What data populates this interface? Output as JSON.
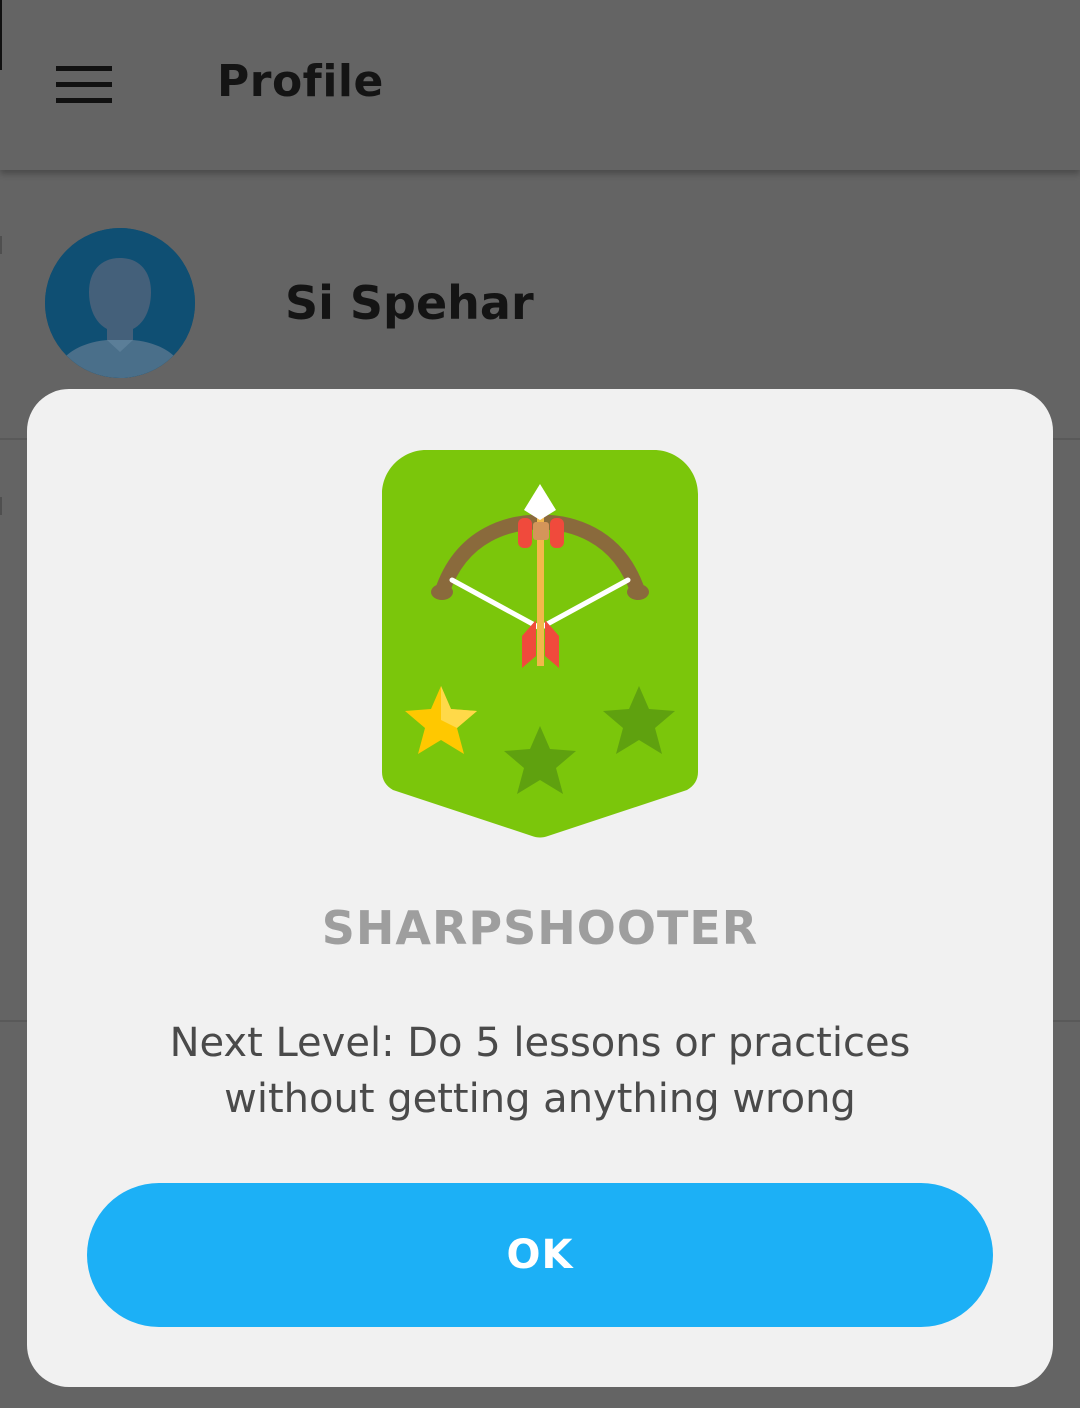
{
  "app_bar": {
    "title": "Profile",
    "menu_icon": "hamburger-menu-icon"
  },
  "profile": {
    "name": "Si Spehar",
    "avatar_icon": "default-avatar-icon"
  },
  "modal": {
    "badge_icon": "bow-and-arrow-badge-icon",
    "stars_total": 3,
    "stars_earned": 1,
    "title": "SHARPSHOOTER",
    "description": "Next Level: Do 5 lessons or practices without getting anything wrong",
    "ok_label": "OK"
  },
  "colors": {
    "overlay_background": "#646464",
    "modal_background": "#f1f1f1",
    "badge_green": "#7bc60b",
    "star_gold": "#ffc800",
    "star_inactive": "#5fa10f",
    "button_blue": "#1cb0f6",
    "title_gray": "#9e9e9e"
  }
}
